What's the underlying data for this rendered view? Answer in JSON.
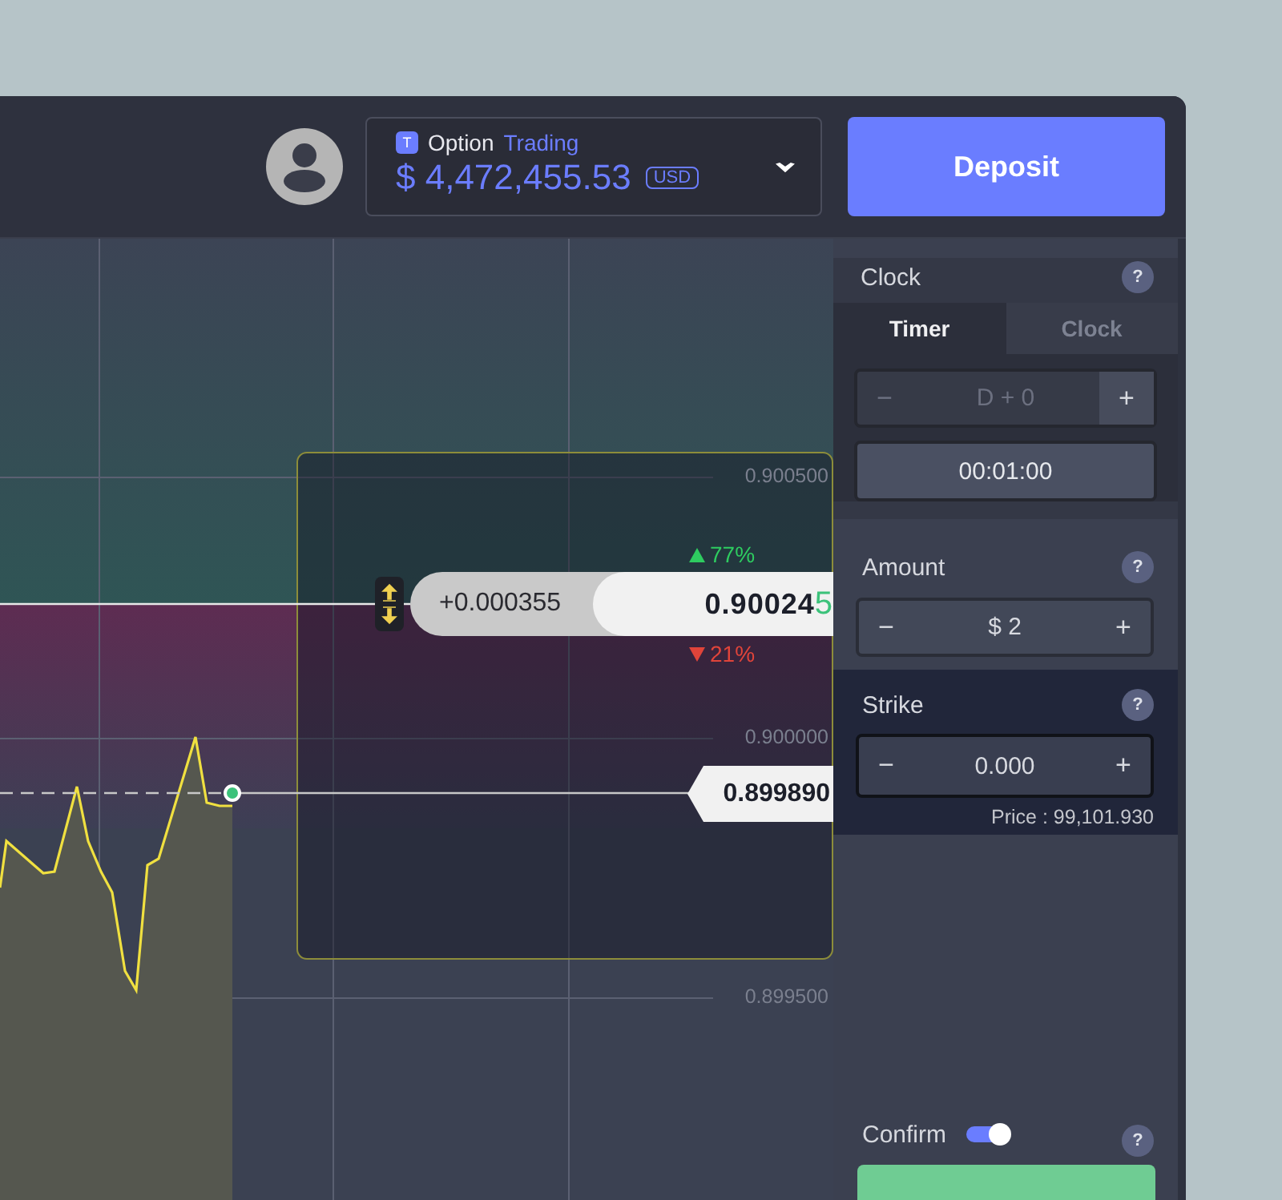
{
  "header": {
    "account": {
      "badge": "T",
      "label": "Option",
      "mode": "Trading",
      "balance": "$ 4,472,455.53",
      "currency": "USD"
    },
    "deposit_button": "Deposit"
  },
  "chart": {
    "price_ticks": [
      "0.900500",
      "0.900000",
      "0.899500"
    ],
    "change": "+0.000355",
    "price_main": "0.90024",
    "price_last_digit": "5",
    "up_payout": "77%",
    "down_payout": "21%",
    "strike_price": "0.899890"
  },
  "sidebar": {
    "clock": {
      "title": "Clock",
      "help": "?",
      "tabs": [
        {
          "label": "Timer",
          "selected": true
        },
        {
          "label": "Clock",
          "selected": false
        }
      ],
      "day_stepper": {
        "minus": "−",
        "value": "D + 0",
        "plus": "+",
        "disabled": true
      },
      "time": "00:01:00"
    },
    "amount": {
      "title": "Amount",
      "help": "?",
      "minus": "−",
      "value": "$ 2",
      "plus": "+"
    },
    "strike": {
      "title": "Strike",
      "help": "?",
      "minus": "−",
      "value": "0.000",
      "plus": "+",
      "price": "Price : 99,101.930"
    },
    "confirm": {
      "label": "Confirm",
      "help": "?",
      "on": true
    }
  }
}
